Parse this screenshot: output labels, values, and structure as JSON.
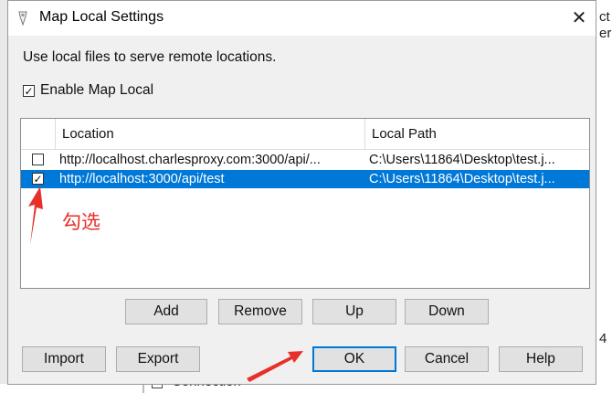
{
  "dialog": {
    "title": "Map Local Settings",
    "close_glyph": "✕",
    "description": "Use local files to serve remote locations.",
    "enable_label": "Enable Map Local",
    "enable_checked": true
  },
  "table": {
    "columns": [
      "Location",
      "Local Path"
    ],
    "rows": [
      {
        "checked": false,
        "selected": false,
        "location": "http://localhost.charlesproxy.com:3000/api/...",
        "local_path": "C:\\Users\\11864\\Desktop\\test.j..."
      },
      {
        "checked": true,
        "selected": true,
        "location": "http://localhost:3000/api/test",
        "local_path": "C:\\Users\\11864\\Desktop\\test.j..."
      }
    ]
  },
  "row_buttons": {
    "add": "Add",
    "remove": "Remove",
    "up": "Up",
    "down": "Down"
  },
  "footer_buttons": {
    "import": "Import",
    "export": "Export",
    "ok": "OK",
    "cancel": "Cancel",
    "help": "Help"
  },
  "annotation": {
    "text": "勾选",
    "color": "#e8302a"
  },
  "background": {
    "right_fragments": [
      "ct",
      "er",
      "4"
    ],
    "bottom_text": "Connection"
  },
  "colors": {
    "selection": "#0078d7",
    "button_face": "#e1e1e1",
    "dialog_bg": "#f0f0f0"
  }
}
